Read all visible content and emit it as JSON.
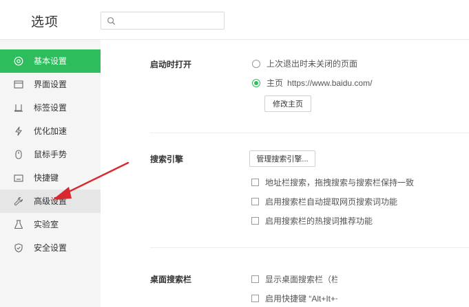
{
  "header": {
    "title": "选项",
    "search_placeholder": "",
    "search_value": ""
  },
  "sidebar": {
    "items": [
      {
        "label": "基本设置",
        "icon": "settings-circle-icon",
        "state": "active"
      },
      {
        "label": "界面设置",
        "icon": "window-icon",
        "state": "normal"
      },
      {
        "label": "标签设置",
        "icon": "tab-icon",
        "state": "normal"
      },
      {
        "label": "优化加速",
        "icon": "lightning-icon",
        "state": "normal"
      },
      {
        "label": "鼠标手势",
        "icon": "mouse-icon",
        "state": "normal"
      },
      {
        "label": "快捷键",
        "icon": "keyboard-icon",
        "state": "normal"
      },
      {
        "label": "高级设置",
        "icon": "wrench-icon",
        "state": "hover"
      },
      {
        "label": "实验室",
        "icon": "flask-icon",
        "state": "normal"
      },
      {
        "label": "安全设置",
        "icon": "shield-icon",
        "state": "normal"
      }
    ]
  },
  "startup": {
    "label": "启动时打开",
    "option_last_session": "上次退出时未关闭的页面",
    "option_homepage": "主页",
    "homepage_url": "https://www.baidu.com/",
    "modify_homepage_button": "修改主页"
  },
  "search_engine": {
    "label": "搜索引擎",
    "manage_button": "管理搜索引擎...",
    "opt1": "地址栏搜索，拖拽搜索与搜索栏保持一致",
    "opt2": "启用搜索栏自动提取网页搜索词功能",
    "opt3": "启用搜索栏的热搜词推荐功能"
  },
  "desktop_search": {
    "label": "桌面搜索栏",
    "opt1": "显示桌面搜索栏（栏",
    "opt2": "启用快捷键 “Alt+It++"
  },
  "colors": {
    "accent": "#2ebd5c",
    "annotation_arrow": "#d9282f"
  }
}
